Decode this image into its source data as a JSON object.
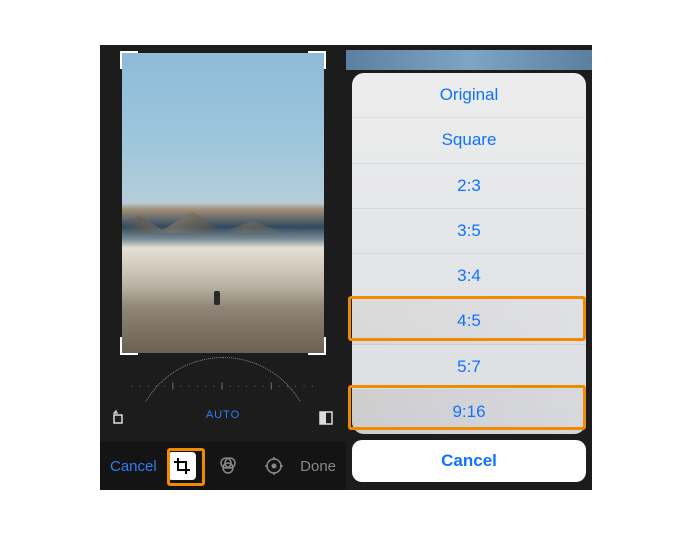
{
  "editor": {
    "auto_label": "AUTO",
    "cancel_label": "Cancel",
    "done_label": "Done",
    "rotate_icon": "rotate-icon",
    "aspect_icon": "aspect-icon",
    "tools": {
      "crop": "crop-icon",
      "filters": "filters-icon",
      "adjust": "adjust-icon"
    }
  },
  "aspect_sheet": {
    "options": [
      {
        "label": "Original"
      },
      {
        "label": "Square"
      },
      {
        "label": "2:3"
      },
      {
        "label": "3:5"
      },
      {
        "label": "3:4"
      },
      {
        "label": "4:5"
      },
      {
        "label": "5:7"
      },
      {
        "label": "9:16"
      }
    ],
    "cancel_label": "Cancel"
  },
  "highlights": {
    "crop_tool": true,
    "ratio_4_5": true,
    "ratio_9_16": true
  },
  "colors": {
    "ios_blue": "#1073ff",
    "highlight_orange": "#f08a00"
  }
}
